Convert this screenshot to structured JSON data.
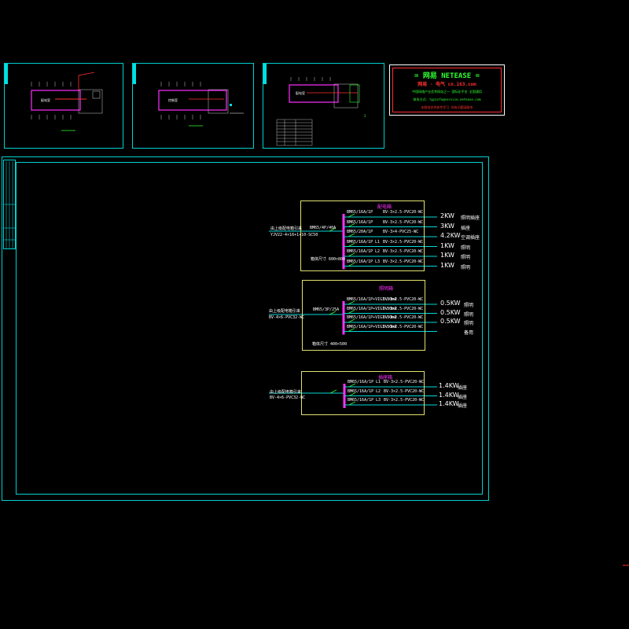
{
  "banner": {
    "title": "= 网易 NETEASE =",
    "subtitle": "网易 · 电气  cn.163.com",
    "line3": "中国网络产业优秀网站之一  国际化平台  全国通用",
    "line4": "联系方式: hypinfo@service.netease.com",
    "line5": "本图纸仅供参考学习  如有问题请联系"
  },
  "panels": [
    {
      "title": "配电箱",
      "incoming_cable": "YJV22-4×16+1×10-SC50",
      "incoming_label": "由上级配电箱引来",
      "main_breaker": "BM65/4P/40A",
      "bottom_note": "箱体尺寸 600×800",
      "circuits": [
        {
          "breaker": "BM65/16A/1P",
          "phase": "",
          "cable": "BV-3×2.5-PVC20-WC",
          "load": "2KW",
          "use": "照明插座"
        },
        {
          "breaker": "BM65/16A/1P",
          "phase": "",
          "cable": "BV-3×2.5-PVC20-WC",
          "load": "3KW",
          "use": "插座"
        },
        {
          "breaker": "BM65/20A/1P",
          "phase": "",
          "cable": "BV-3×4-PVC25-WC",
          "load": "4.2KW",
          "use": "空调插座"
        },
        {
          "breaker": "BM65/16A/1P",
          "phase": "L1",
          "cable": "BV-3×2.5-PVC20-WC",
          "load": "1KW",
          "use": "照明"
        },
        {
          "breaker": "BM65/16A/1P",
          "phase": "L2",
          "cable": "BV-3×2.5-PVC20-WC",
          "load": "1KW",
          "use": "照明"
        },
        {
          "breaker": "BM65/16A/1P",
          "phase": "L3",
          "cable": "BV-3×2.5-PVC20-WC",
          "load": "1KW",
          "use": "照明"
        }
      ]
    },
    {
      "title": "照明箱",
      "incoming_cable": "BV-4×6-PVC32-WC",
      "incoming_label": "由上级配电箱引来",
      "main_breaker": "BM65/3P/25A",
      "bottom_note": "箱体尺寸 400×500",
      "circuits": [
        {
          "breaker": "BM65/16A/1P+VIGI-30mA",
          "phase": "",
          "cable": "BV-3×2.5-PVC20-WC",
          "load": "0.5KW",
          "use": "照明"
        },
        {
          "breaker": "BM65/16A/1P+VIGI-30mA",
          "phase": "",
          "cable": "BV-3×2.5-PVC20-WC",
          "load": "0.5KW",
          "use": "照明"
        },
        {
          "breaker": "BM65/16A/1P+VIGI-30mA",
          "phase": "",
          "cable": "BV-3×2.5-PVC20-WC",
          "load": "0.5KW",
          "use": "照明"
        },
        {
          "breaker": "BM65/16A/1P+VIGI-30mA",
          "phase": "",
          "cable": "BV-3×2.5-PVC20-WC",
          "load": "",
          "use": "备用"
        }
      ]
    },
    {
      "title": "插座箱",
      "incoming_cable": "BV-4×6-PVC32-WC",
      "incoming_label": "由上级配电箱引来",
      "main_breaker": "",
      "bottom_note": "",
      "circuits": [
        {
          "breaker": "BM65/16A/1P",
          "phase": "L1",
          "cable": "BV-3×2.5-PVC20-WC",
          "load": "1.4KW",
          "use": "插座"
        },
        {
          "breaker": "BM65/16A/1P",
          "phase": "L2",
          "cable": "BV-3×2.5-PVC20-WC",
          "load": "1.4KW",
          "use": "插座"
        },
        {
          "breaker": "BM65/16A/1P",
          "phase": "L3",
          "cable": "BV-3×2.5-PVC20-WC",
          "load": "1.4KW",
          "use": "插座"
        }
      ]
    }
  ],
  "thumbnails": [
    {
      "room_label": "配电室"
    },
    {
      "room_label": "控制室"
    },
    {
      "room_label": "配电室"
    }
  ],
  "colors": {
    "frame": "#00d0d0",
    "bus": "#ff30ff",
    "wire": "#00d8d8",
    "panel_border": "#e0e070",
    "breaker": "#30ff30"
  }
}
